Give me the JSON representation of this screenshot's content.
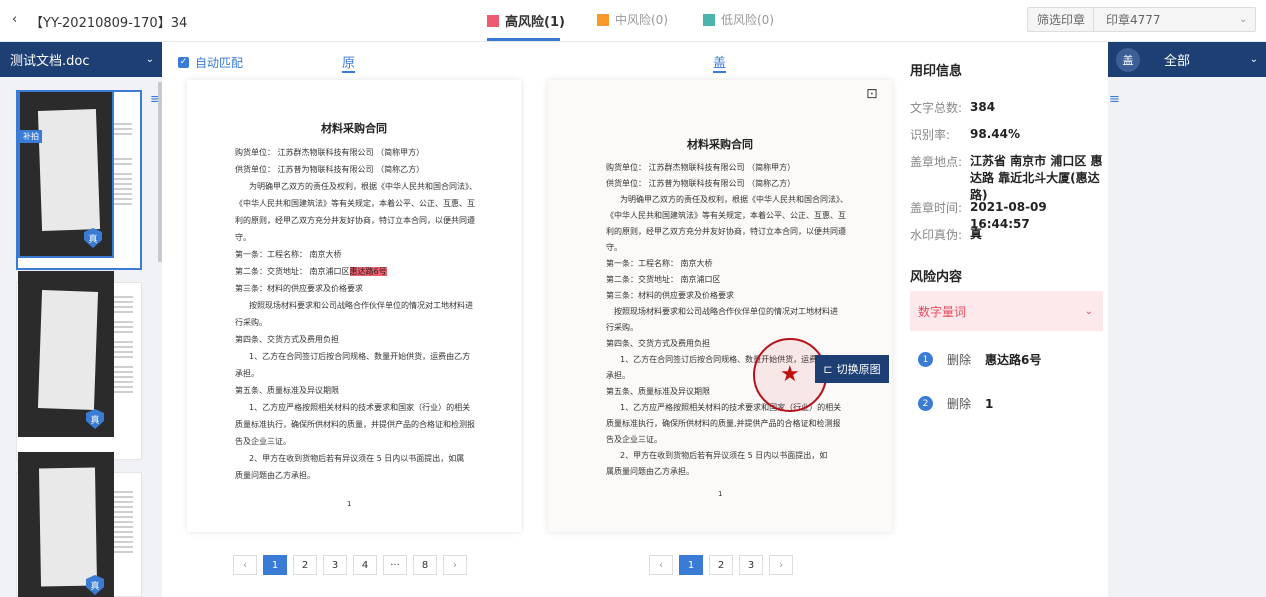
{
  "header": {
    "back_icon": "chevron-left-icon",
    "title": "【YY-20210809-170】34",
    "tabs": [
      {
        "label": "高风险(1)",
        "color": "#ef5a73"
      },
      {
        "label": "中风险(0)",
        "color": "#f79a2b"
      },
      {
        "label": "低风险(0)",
        "color": "#4db3ad"
      }
    ],
    "filter_label": "筛选印章",
    "filter_value": "印章4777"
  },
  "left": {
    "file_name": "测试文档.doc",
    "thumbnails": 3
  },
  "center": {
    "auto_match_label": "自动匹配",
    "original_label": "原",
    "stamped_label": "盖",
    "switch_button_label": "切换原图",
    "original_doc": {
      "title": "材料采购合同",
      "lines": [
        "购货单位：        江苏群杰物联科技有限公司        （简称甲方）",
        "供货单位：        江苏普为物联科技有限公司        （简称乙方）",
        "为明确甲乙双方的责任及权利，根据《中华人民共和国合同法》、",
        "《中华人民共和国建筑法》等有关规定，本着公平、公正、互惠、互",
        "利的原则，经甲乙双方充分并友好协商，特订立本合同，以便共同遵",
        "守。",
        "第一条：工程名称：    南京大桥",
        "第二条：交货地址：    南京浦口区",
        "第三条：材料的供应要求及价格要求",
        "按照现场材料要求和公司战略合作伙伴单位的情况对工地材料进",
        "行采购。",
        "第四条、交货方式及费用负担",
        "1、乙方在合同签订后按合同规格、数量开始供货，运费由乙方",
        "承担。",
        "第五条、质量标准及异议期限",
        "1、乙方应严格按照相关材料的技术要求和国家（行业）的相关",
        "质量标准执行，确保所供材料的质量，并提供产品的合格证和检测报",
        "告及企业三证。",
        "2、甲方在收到货物后若有异议须在  5 日内以书面提出，如属",
        "质量问题由乙方承担。"
      ],
      "highlight": "惠达路6号",
      "footer_num": "1"
    },
    "stamped_doc": {
      "title": "材料采购合同",
      "lines": [
        "购货单位：      江苏群杰物联科技有限公司          （简称甲方）",
        "供货单位：      江苏普为物联科技有限公司          （简称乙方）",
        "为明确甲乙双方的责任及权利，根据《中华人民共和国合同法》、",
        "《中华人民共和国建筑法》等有关规定，本着公平、公正、互惠、互",
        "利的原则，经甲乙双方充分并友好协商，特订立本合同，以便共同遵",
        "守。",
        "第一条：工程名称：    南京大桥",
        "第二条：交货地址：    南京浦口区",
        "第三条：材料的供应要求及价格要求",
        "按照现场材料要求和公司战略合作伙伴单位的情况对工地材料进",
        "行采购。",
        "第四条、交货方式及费用负担",
        "1、乙方在合同签订后按合同规格、数量开始供货，运费由乙方",
        "承担。",
        "第五条、质量标准及异议期限",
        "1、乙方应严格按照相关材料的技术要求和国家（行业）的相关",
        "质量标准执行，确保所供材料的质量,并提供产品的合格证和检测报",
        "告及企业三证。",
        "2、甲方在收到货物后若有异议须在   5   日内以书面提出，如",
        "属质量问题由乙方承担。"
      ],
      "footer_num": "1"
    },
    "pager_left": [
      "1",
      "2",
      "3",
      "4",
      "···",
      "8"
    ],
    "pager_right": [
      "1",
      "2",
      "3"
    ],
    "pager_active": "1"
  },
  "info": {
    "section_title": "用印信息",
    "rows": [
      {
        "key": "文字总数:",
        "value": "384"
      },
      {
        "key": "识别率:",
        "value": "98.44%"
      },
      {
        "key": "盖章地点:",
        "value": "江苏省 南京市 浦口区 惠达路 靠近北斗大厦(惠达路)"
      },
      {
        "key": "盖章时间:",
        "value": "2021-08-09 16:44:57"
      },
      {
        "key": "水印真伪:",
        "value": "真"
      }
    ],
    "risk_title": "风险内容",
    "risk_category": "数字量词",
    "risk_items": [
      {
        "num": "1",
        "op": "删除",
        "word": "惠达路6号"
      },
      {
        "num": "2",
        "op": "删除",
        "word": "1"
      }
    ]
  },
  "right": {
    "stamp_label": "盖",
    "all_label": "全部",
    "retake_badge": "补拍",
    "shield_text": "真"
  }
}
